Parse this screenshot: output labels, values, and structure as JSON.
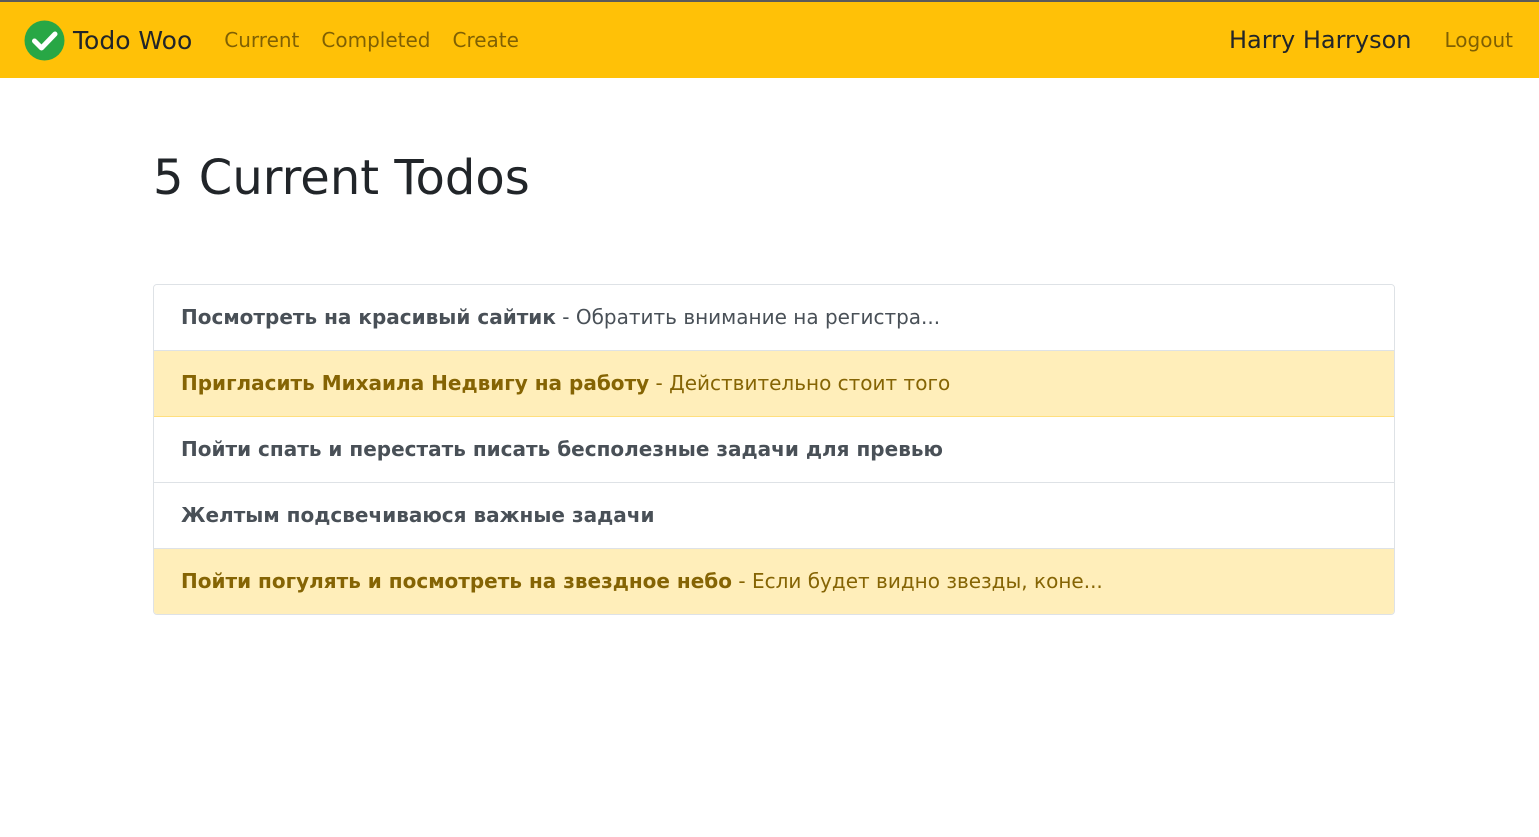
{
  "colors": {
    "navbar_bg": "#ffc107",
    "brand_icon": "#28a745",
    "important_bg": "#ffeeba",
    "important_text": "#856404"
  },
  "navbar": {
    "brand_icon": "check-circle-icon",
    "brand_text": "Todo Woo",
    "links": [
      {
        "label": "Current"
      },
      {
        "label": "Completed"
      },
      {
        "label": "Create"
      }
    ],
    "username": "Harry Harryson",
    "logout_label": "Logout"
  },
  "main": {
    "title": "5 Current Todos",
    "todos": [
      {
        "title": "Посмотреть на красивый сайтик",
        "separator": " - ",
        "memo": "Обратить внимание на регистра...",
        "important": false
      },
      {
        "title": "Пригласить Михаила Недвигу на работу",
        "separator": " - ",
        "memo": "Действительно стоит того",
        "important": true
      },
      {
        "title": "Пойти спать и перестать писать бесполезные задачи для превью",
        "separator": "",
        "memo": "",
        "important": false
      },
      {
        "title": "Желтым подсвечиваюся важные задачи",
        "separator": "",
        "memo": "",
        "important": false
      },
      {
        "title": "Пойти погулять и посмотреть на звездное небо",
        "separator": " - ",
        "memo": "Если будет видно звезды, коне...",
        "important": true
      }
    ]
  }
}
